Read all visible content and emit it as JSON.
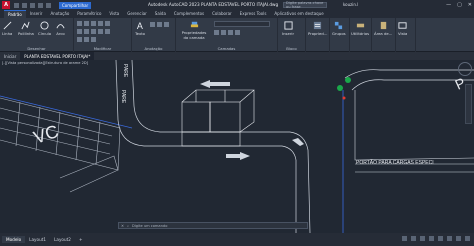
{
  "app": {
    "logo": "A",
    "share_label": "Compartilhar",
    "title": "Autodesk AutoCAD 2023   PLANTA EDSTAVEL PORTO ITAJAI.dwg",
    "search_placeholder": "Digite palavra-chave ou frase",
    "user": "kouzin.l"
  },
  "ribbon_tabs": [
    "Padrão",
    "Inserir",
    "Anotação",
    "Paramétrico",
    "Vista",
    "Gerenciar",
    "Saída",
    "Complementos",
    "Colaborar",
    "Express Tools",
    "Aplicativos em destaque"
  ],
  "ribbon": {
    "draw": {
      "buttons": [
        "Linha",
        "Polilinha",
        "Círculo",
        "Arco"
      ],
      "panel": "Desenhar"
    },
    "modify": {
      "panel": "Modificar"
    },
    "annotation": {
      "buttons": [
        "Texto"
      ],
      "panel": "Anotação"
    },
    "layers": {
      "buttons": [
        "Propriedades da camada"
      ],
      "panel": "Camadas"
    },
    "block": {
      "buttons": [
        "Inserir"
      ],
      "panel": "Bloco"
    },
    "properties": {
      "buttons": [
        "Propried..."
      ]
    },
    "groups": {
      "buttons": [
        "Grupos"
      ]
    },
    "utilities": {
      "buttons": [
        "Utilitários"
      ]
    },
    "clipboard": {
      "buttons": [
        "Área de..."
      ]
    },
    "view": {
      "buttons": [
        "Vista"
      ]
    }
  },
  "file_tabs": [
    "Iniciar",
    "PLANTA EDSTAVEL PORTO ITAJAI*"
  ],
  "canvas": {
    "view_label": "[-][Vista personalizada][Estrutura de arame 2D]",
    "drawing_texts": [
      "VC",
      "PARE",
      "PARE",
      "PORTÃO PARA CARGAS ESPECI",
      "P",
      "P"
    ]
  },
  "command_placeholder": "Digite um comando",
  "layout_tabs": [
    "Modelo",
    "Layout1",
    "Layout2"
  ],
  "colors": {
    "accent": "#2d6ad0",
    "canvas": "#212833",
    "road_line": "#cfd5de",
    "blue_line": "#3a6be0",
    "green": "#1aa84a",
    "red": "#e03a2f"
  }
}
